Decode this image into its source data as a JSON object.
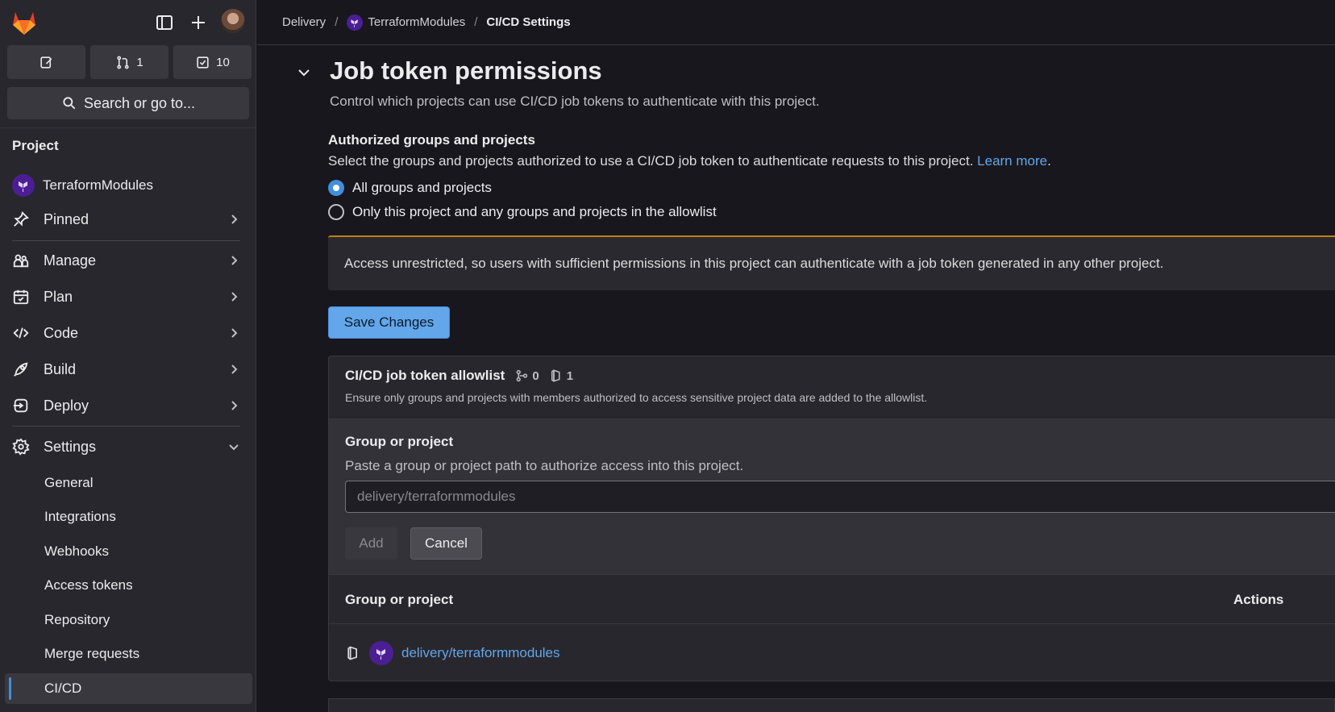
{
  "sidebar": {
    "counts": {
      "merge_requests": "1",
      "todos": "10"
    },
    "search_label": "Search or go to...",
    "section_label": "Project",
    "project_name": "TerraformModules",
    "nav": [
      {
        "label": "Pinned"
      },
      {
        "label": "Manage"
      },
      {
        "label": "Plan"
      },
      {
        "label": "Code"
      },
      {
        "label": "Build"
      },
      {
        "label": "Deploy"
      },
      {
        "label": "Settings"
      }
    ],
    "settings_items": [
      {
        "label": "General"
      },
      {
        "label": "Integrations"
      },
      {
        "label": "Webhooks"
      },
      {
        "label": "Access tokens"
      },
      {
        "label": "Repository"
      },
      {
        "label": "Merge requests"
      },
      {
        "label": "CI/CD"
      }
    ]
  },
  "breadcrumb": {
    "group": "Delivery",
    "project": "TerraformModules",
    "current": "CI/CD Settings"
  },
  "page": {
    "title": "Job token permissions",
    "subtitle": "Control which projects can use CI/CD job tokens to authenticate with this project.",
    "auth_title": "Authorized groups and projects",
    "auth_desc": "Select the groups and projects authorized to use a CI/CD job token to authenticate requests to this project.",
    "learn_more": "Learn more",
    "options": [
      {
        "label": "All groups and projects",
        "checked": true
      },
      {
        "label": "Only this project and any groups and projects in the allowlist",
        "checked": false
      }
    ],
    "alert_text": "Access unrestricted, so users with sufficient permissions in this project can authenticate with a job token generated in any other project.",
    "save_label": "Save Changes"
  },
  "allowlist": {
    "title": "CI/CD job token allowlist",
    "group_count": "0",
    "project_count": "1",
    "description": "Ensure only groups and projects with members authorized to access sensitive project data are added to the allowlist.",
    "form_label": "Group or project",
    "form_help": "Paste a group or project path to authorize access into this project.",
    "input_placeholder": "delivery/terraformmodules",
    "add_label": "Add",
    "cancel_label": "Cancel",
    "columns": [
      "Group or project",
      "Actions"
    ],
    "rows": [
      {
        "path": "delivery/terraformmodules"
      }
    ]
  }
}
